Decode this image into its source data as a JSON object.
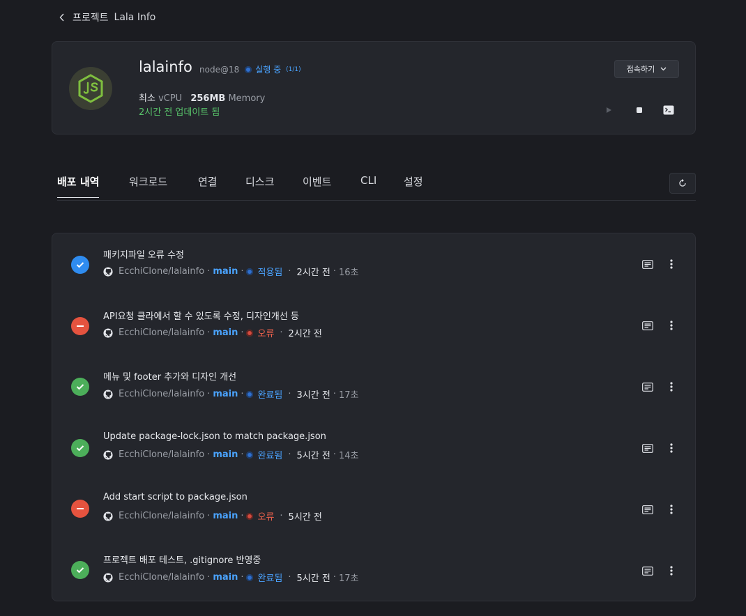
{
  "breadcrumb": {
    "section": "프로젝트",
    "project": "Lala Info"
  },
  "app": {
    "name": "lalainfo",
    "runtime": "node@18",
    "status": "실행 중",
    "status_count": "(1/1)",
    "spec_prefix": "최소",
    "cpu": "vCPU",
    "memory_value": "256MB",
    "memory_label": "Memory",
    "updated": "2시간 전 업데이트 됨",
    "connect_label": "접속하기"
  },
  "tabs": [
    {
      "label": "배포 내역"
    },
    {
      "label": "워크로드"
    },
    {
      "label": "연결"
    },
    {
      "label": "디스크"
    },
    {
      "label": "이벤트"
    },
    {
      "label": "CLI"
    },
    {
      "label": "설정"
    }
  ],
  "deployments": [
    {
      "title": "패키지파일 오류 수정",
      "repo": "EcchiClone/lalainfo",
      "branch": "main",
      "state": "적용됨",
      "time": "2시간 전",
      "duration": "16초"
    },
    {
      "title": "API요청 클라에서 할 수 있도록 수정, 디자인개선 등",
      "repo": "EcchiClone/lalainfo",
      "branch": "main",
      "state": "오류",
      "time": "2시간 전",
      "duration": ""
    },
    {
      "title": "메뉴 및 footer 추가와 디자인 개선",
      "repo": "EcchiClone/lalainfo",
      "branch": "main",
      "state": "완료됨",
      "time": "3시간 전",
      "duration": "17초"
    },
    {
      "title": "Update package-lock.json to match package.json",
      "repo": "EcchiClone/lalainfo",
      "branch": "main",
      "state": "완료됨",
      "time": "5시간 전",
      "duration": "14초"
    },
    {
      "title": "Add start script to package.json",
      "repo": "EcchiClone/lalainfo",
      "branch": "main",
      "state": "오류",
      "time": "5시간 전",
      "duration": ""
    },
    {
      "title": "프로젝트 배포 테스트, .gitignore 반영중",
      "repo": "EcchiClone/lalainfo",
      "branch": "main",
      "state": "완료됨",
      "time": "5시간 전",
      "duration": "17초"
    }
  ],
  "separator": "·",
  "colors": {
    "accent": "#4aa3ff",
    "success": "#4cae5a",
    "error": "#e5533f",
    "applied": "#2f8cf0"
  }
}
